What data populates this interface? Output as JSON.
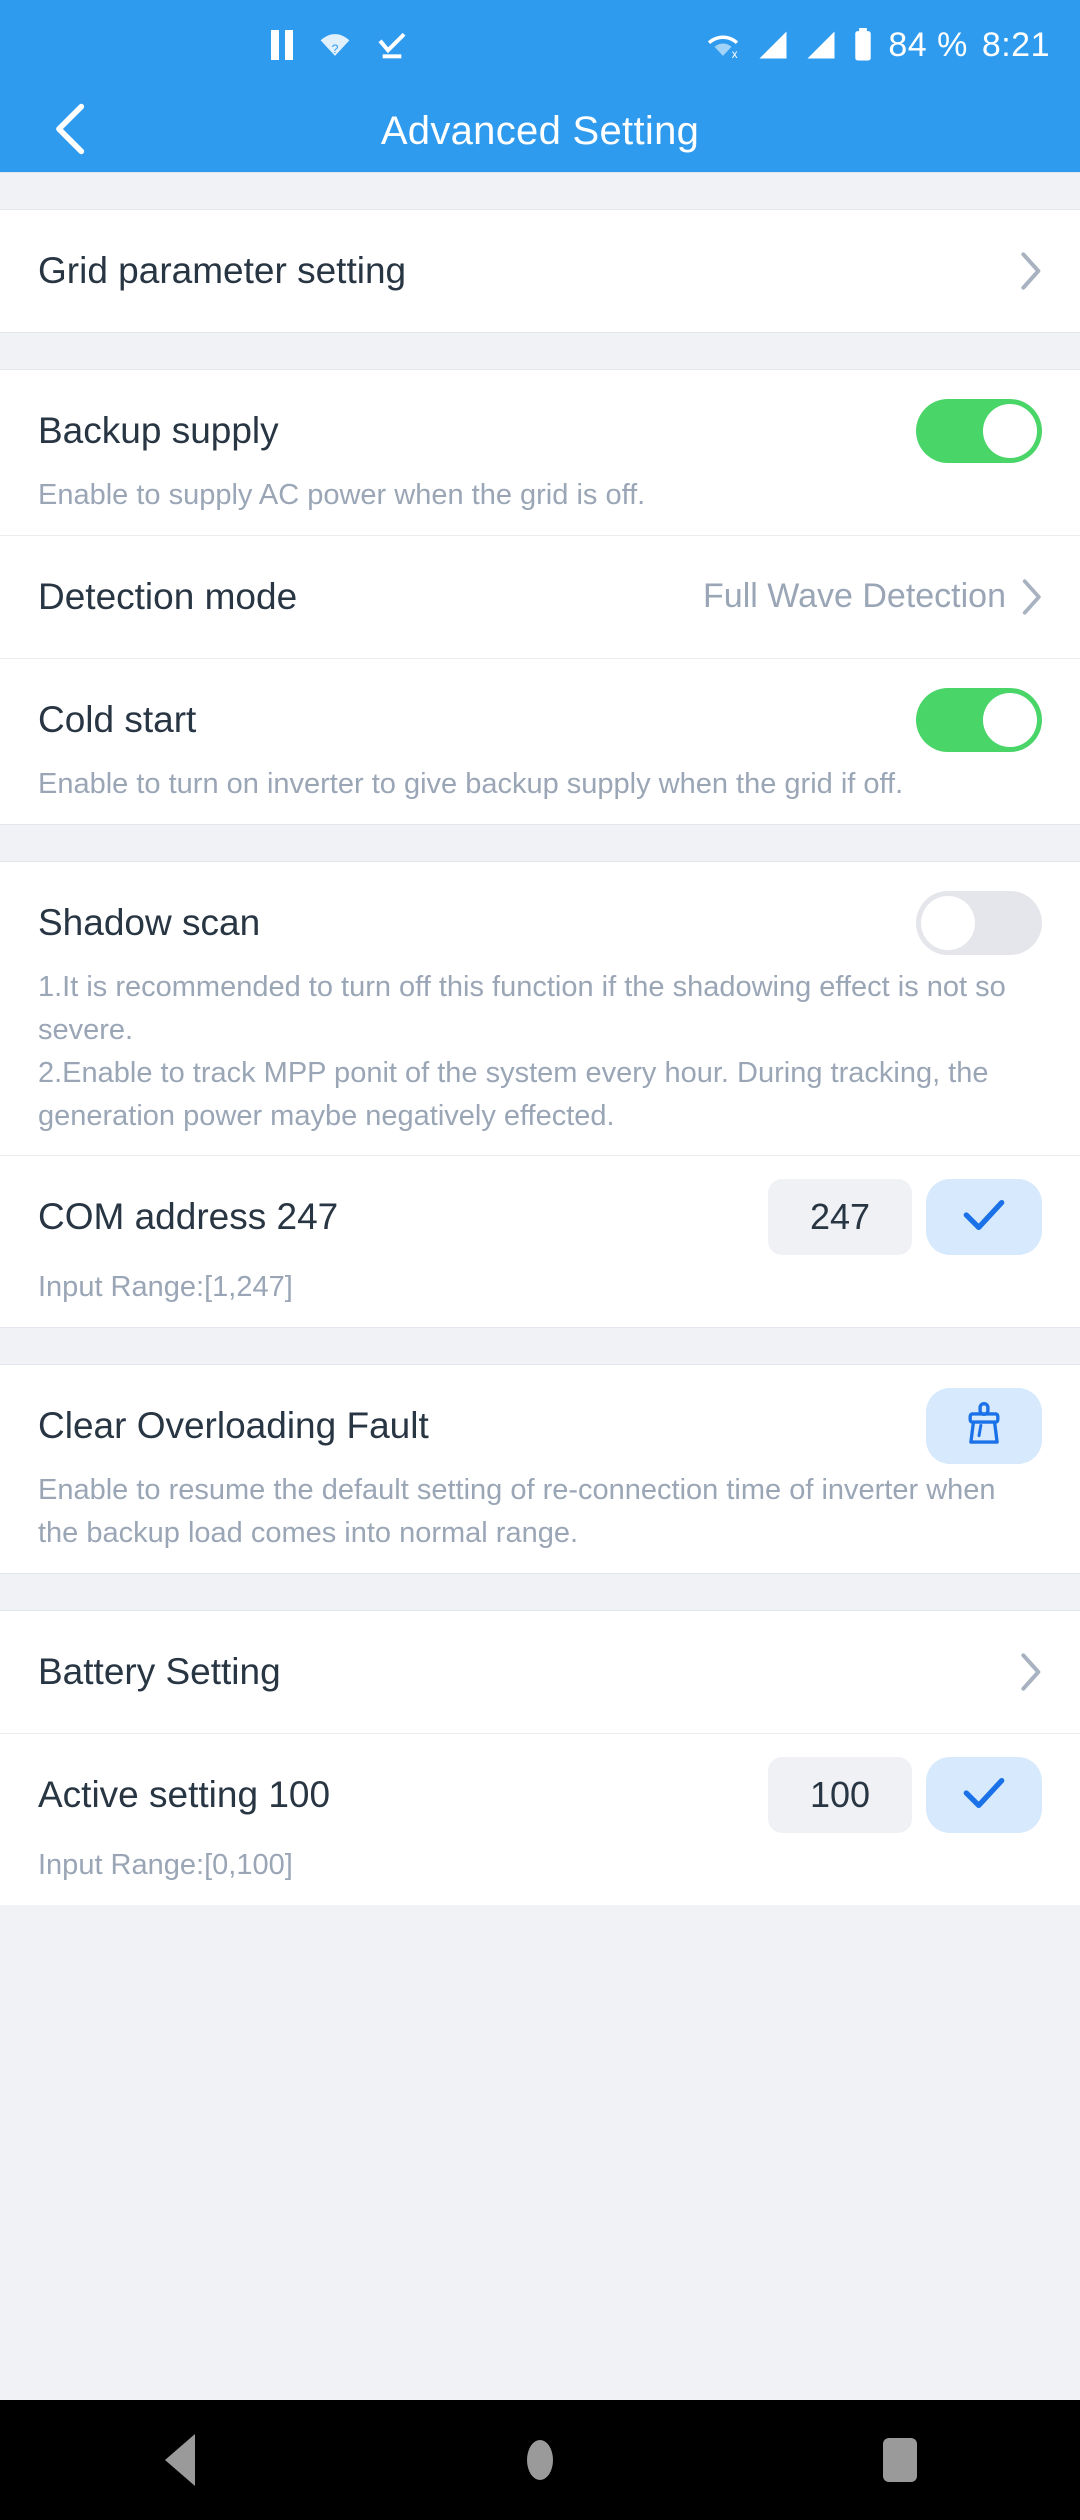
{
  "status_bar": {
    "left_icons": [
      "pause-icon",
      "location-unknown-icon",
      "download-complete-icon"
    ],
    "right_icons": [
      "wifi-off-icon",
      "signal-1-icon",
      "signal-2-icon",
      "battery-icon"
    ],
    "battery_text": "84 %",
    "time": "8:21"
  },
  "app_bar": {
    "back_icon": "chevron-left-icon",
    "title": "Advanced Setting"
  },
  "sections": {
    "grid": {
      "title": "Grid  parameter setting",
      "chevron": "chevron-right-icon"
    },
    "backup": {
      "title": "Backup supply",
      "desc": "Enable to supply AC power when the grid is off.",
      "toggle_state": "on"
    },
    "detection": {
      "title": "Detection mode",
      "value": "Full Wave Detection",
      "chevron": "chevron-right-icon"
    },
    "cold_start": {
      "title": "Cold start",
      "desc": "Enable to turn on inverter to give backup supply when the grid if off.",
      "toggle_state": "on"
    },
    "shadow_scan": {
      "title": "Shadow scan",
      "desc_line1": "1.It is recommended to turn off this function if the shadowing effect is not so severe.",
      "desc_line2": "2.Enable to track MPP ponit of the system every hour. During tracking, the generation power maybe negatively effected.",
      "toggle_state": "off"
    },
    "com_address": {
      "title": "COM address  247",
      "input_value": "247",
      "input_placeholder": "247",
      "range_hint": "Input Range:[1,247]",
      "confirm_icon": "check-icon"
    },
    "clear_fault": {
      "title": "Clear Overloading Fault",
      "desc": "Enable to resume the default setting of re-connection time of inverter when the backup load comes into normal range.",
      "action_icon": "brush-icon"
    },
    "battery_setting": {
      "title": "Battery Setting",
      "chevron": "chevron-right-icon"
    },
    "active_setting": {
      "title": "Active setting  100",
      "input_value": "100",
      "input_placeholder": "100",
      "range_hint": "Input Range:[0,100]",
      "confirm_icon": "check-icon"
    }
  },
  "nav_bar": {
    "back": "back-triangle-icon",
    "home": "home-circle-icon",
    "recents": "recents-square-icon"
  },
  "colors": {
    "header_blue": "#2f9bee",
    "toggle_on_green": "#4ad568",
    "toggle_off_grey": "#e4e6eb",
    "accent_blue": "#1b72e8",
    "accent_blue_bg": "#d7e9fc",
    "title_text": "#283543",
    "muted_text": "#9aa6b6",
    "section_bg": "#f0f2f6"
  }
}
